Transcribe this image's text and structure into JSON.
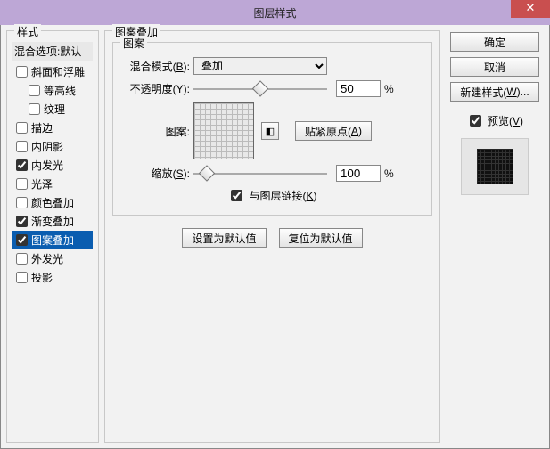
{
  "window": {
    "title": "图层样式",
    "close_glyph": "✕"
  },
  "left": {
    "legend": "样式",
    "blend_header": "混合选项:默认",
    "items": [
      {
        "label": "斜面和浮雕",
        "checked": false,
        "indent": 0
      },
      {
        "label": "等高线",
        "checked": false,
        "indent": 1
      },
      {
        "label": "纹理",
        "checked": false,
        "indent": 1
      },
      {
        "label": "描边",
        "checked": false,
        "indent": 0
      },
      {
        "label": "内阴影",
        "checked": false,
        "indent": 0
      },
      {
        "label": "内发光",
        "checked": true,
        "indent": 0
      },
      {
        "label": "光泽",
        "checked": false,
        "indent": 0
      },
      {
        "label": "颜色叠加",
        "checked": false,
        "indent": 0
      },
      {
        "label": "渐变叠加",
        "checked": true,
        "indent": 0
      },
      {
        "label": "图案叠加",
        "checked": true,
        "indent": 0,
        "selected": true
      },
      {
        "label": "外发光",
        "checked": false,
        "indent": 0
      },
      {
        "label": "投影",
        "checked": false,
        "indent": 0
      }
    ]
  },
  "center": {
    "outer_legend": "图案叠加",
    "inner_legend": "图案",
    "blend_mode_label_pre": "混合模式(",
    "blend_mode_key": "B",
    "blend_mode_label_post": "):",
    "blend_mode_value": "叠加",
    "opacity_label_pre": "不透明度(",
    "opacity_key": "Y",
    "opacity_label_post": "):",
    "opacity_value": "50",
    "opacity_unit": "%",
    "opacity_thumb_pct": 50,
    "pattern_label": "图案:",
    "mini_btn_glyph": "◧",
    "snap_label_pre": "贴紧原点(",
    "snap_key": "A",
    "snap_label_post": ")",
    "scale_label_pre": "缩放(",
    "scale_key": "S",
    "scale_label_post": "):",
    "scale_value": "100",
    "scale_unit": "%",
    "scale_thumb_pct": 10,
    "link_checked": true,
    "link_label_pre": "与图层链接(",
    "link_key": "K",
    "link_label_post": ")",
    "set_default": "设置为默认值",
    "reset_default": "复位为默认值"
  },
  "right": {
    "ok": "确定",
    "cancel": "取消",
    "new_style_pre": "新建样式(",
    "new_style_key": "W",
    "new_style_post": ")...",
    "preview_checked": true,
    "preview_label_pre": "预览(",
    "preview_key": "V",
    "preview_label_post": ")"
  }
}
